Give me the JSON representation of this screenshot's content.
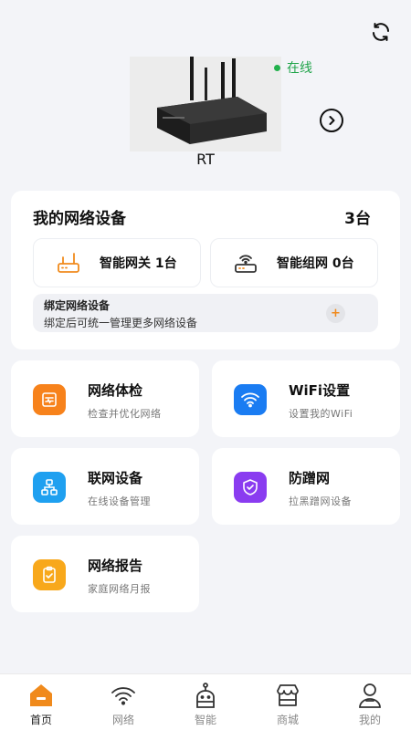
{
  "header": {
    "refresh_icon": "refresh-icon"
  },
  "device": {
    "name": "RT",
    "status": "在线",
    "status_color": "#22b14c"
  },
  "my_devices": {
    "title": "我的网络设备",
    "count": "3台",
    "gateway": {
      "label": "智能网关  1台",
      "icon": "router-icon"
    },
    "mesh": {
      "label": "智能组网  0台",
      "icon": "mesh-router-icon"
    },
    "bind": {
      "title": "绑定网络设备",
      "subtitle": "绑定后可统一管理更多网络设备",
      "icon": "plus-icon"
    }
  },
  "features": [
    {
      "title": "网络体检",
      "subtitle": "检查并优化网络",
      "color": "#f7821b",
      "icon": "health-check-icon"
    },
    {
      "title": "WiFi设置",
      "subtitle": "设置我的WiFi",
      "color": "#1a7cf2",
      "icon": "wifi-icon"
    },
    {
      "title": "联网设备",
      "subtitle": "在线设备管理",
      "color": "#1fa0f0",
      "icon": "network-topology-icon"
    },
    {
      "title": "防蹭网",
      "subtitle": "拉黑蹭网设备",
      "color": "#8a3cf0",
      "icon": "shield-check-icon"
    },
    {
      "title": "网络报告",
      "subtitle": "家庭网络月报",
      "color": "#f8a81b",
      "icon": "report-icon"
    }
  ],
  "tabs": [
    {
      "label": "首页",
      "icon": "home-icon",
      "active": true
    },
    {
      "label": "网络",
      "icon": "wifi-icon",
      "active": false
    },
    {
      "label": "智能",
      "icon": "robot-icon",
      "active": false
    },
    {
      "label": "商城",
      "icon": "store-icon",
      "active": false
    },
    {
      "label": "我的",
      "icon": "profile-icon",
      "active": false
    }
  ],
  "colors": {
    "accent": "#f08a1c",
    "background": "#f3f4f8"
  }
}
